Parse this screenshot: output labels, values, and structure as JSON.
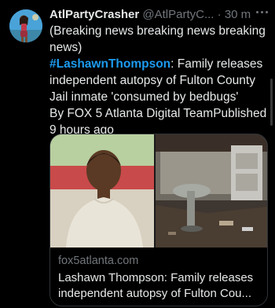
{
  "tweet": {
    "display_name": "AtlPartyCrasher",
    "handle": "@AtlPartyC...",
    "separator": "·",
    "time": "30 m",
    "text_lines": [
      "(Breaking news breaking news breaking news)"
    ],
    "hashtag": "#LashawnThompson",
    "headline_rest": ": Family releases independent autopsy of Fulton County Jail inmate 'consumed by bedbugs'",
    "byline": "By FOX 5 Atlanta Digital TeamPublished 9 hours ago"
  },
  "card": {
    "domain": "fox5atlanta.com",
    "title_line1": "Lashawn Thompson: Family releases",
    "title_line2": "independent autopsy of Fulton Cou..."
  },
  "icons": {
    "more": "more-horizontal-icon",
    "avatar": "user-avatar"
  },
  "colors": {
    "background": "#000000",
    "text": "#e7e9ea",
    "secondary": "#71767b",
    "link": "#1d9bf0",
    "border": "#2f3336"
  }
}
